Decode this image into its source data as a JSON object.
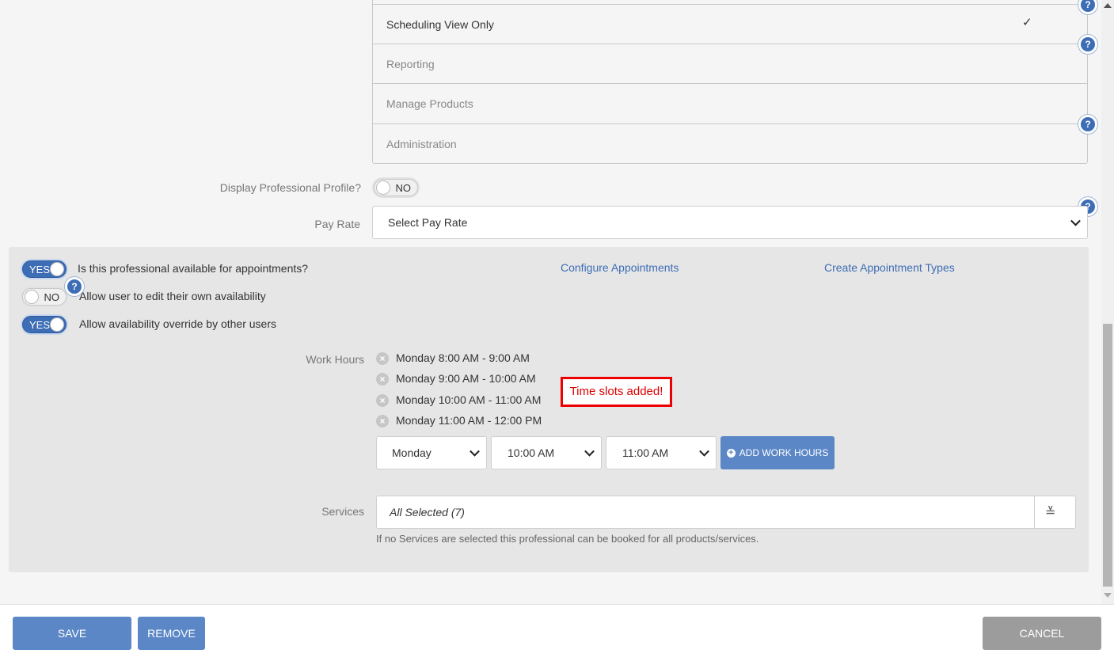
{
  "roles": [
    {
      "label": "Scheduling View Only",
      "checked": true
    },
    {
      "label": "Reporting",
      "checked": false
    },
    {
      "label": "Manage Products",
      "checked": false
    },
    {
      "label": "Administration",
      "checked": false
    }
  ],
  "check_glyph": "✓",
  "help_glyph": "?",
  "display_profile": {
    "label": "Display Professional Profile?",
    "toggle": "NO"
  },
  "pay_rate": {
    "label": "Pay Rate",
    "value": "Select Pay Rate"
  },
  "availability": {
    "appointments": {
      "toggle": "YES",
      "label": "Is this professional available for appointments?"
    },
    "edit_own": {
      "toggle": "NO",
      "label": "Allow user to edit their own availability"
    },
    "override": {
      "toggle": "YES",
      "label": "Allow availability override by other users"
    },
    "configure_link": "Configure Appointments",
    "create_types_link": "Create Appointment Types"
  },
  "work_hours": {
    "label": "Work Hours",
    "slots": [
      "Monday 8:00 AM - 9:00 AM",
      "Monday 9:00 AM - 10:00 AM",
      "Monday 10:00 AM - 11:00 AM",
      "Monday 11:00 AM - 12:00 PM"
    ],
    "remove_glyph": "×",
    "toast": "Time slots added!",
    "day_select": "Monday",
    "start_select": "10:00 AM",
    "end_select": "11:00 AM",
    "add_button": "ADD WORK HOURS",
    "add_glyph": "+"
  },
  "services": {
    "label": "Services",
    "value": "All Selected (7)",
    "hint": "If no Services are selected this professional can be booked for all products/services.",
    "expand_glyph": "≚"
  },
  "footer": {
    "save": "SAVE",
    "remove": "REMOVE",
    "cancel": "CANCEL"
  },
  "colors": {
    "accent": "#3d6db5",
    "button_blue": "#5b87c7",
    "button_gray": "#9c9c9c",
    "alert_red": "#e00000"
  }
}
